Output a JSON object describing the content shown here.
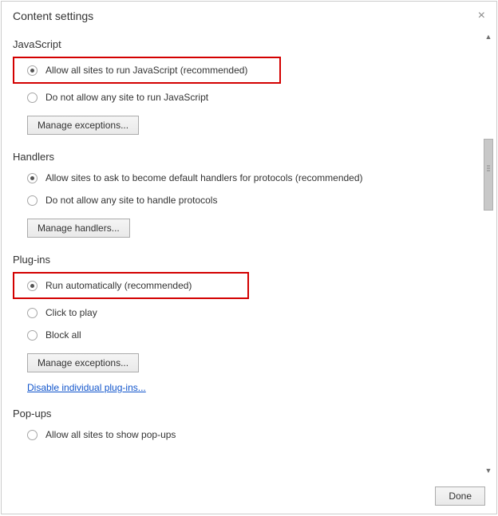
{
  "dialog": {
    "title": "Content settings"
  },
  "sections": {
    "javascript": {
      "title": "JavaScript",
      "options": {
        "allow": "Allow all sites to run JavaScript (recommended)",
        "deny": "Do not allow any site to run JavaScript"
      },
      "button": "Manage exceptions..."
    },
    "handlers": {
      "title": "Handlers",
      "options": {
        "allow": "Allow sites to ask to become default handlers for protocols (recommended)",
        "deny": "Do not allow any site to handle protocols"
      },
      "button": "Manage handlers..."
    },
    "plugins": {
      "title": "Plug-ins",
      "options": {
        "auto": "Run automatically (recommended)",
        "click": "Click to play",
        "block": "Block all"
      },
      "button": "Manage exceptions...",
      "link": "Disable individual plug-ins..."
    },
    "popups": {
      "title": "Pop-ups",
      "options": {
        "allow": "Allow all sites to show pop-ups"
      }
    }
  },
  "footer": {
    "done": "Done"
  }
}
